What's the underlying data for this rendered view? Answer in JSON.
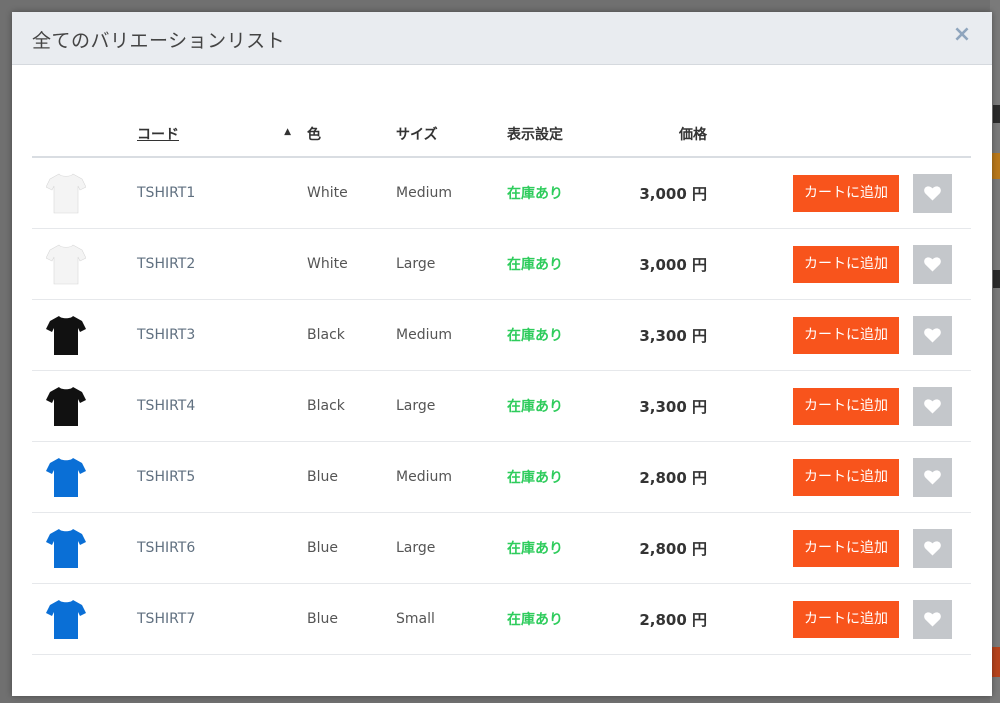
{
  "modal": {
    "title": "全てのバリエーションリスト",
    "close_label": "×"
  },
  "table": {
    "headers": {
      "code": "コード",
      "sort_indicator": "▲",
      "color": "色",
      "size": "サイズ",
      "stock": "表示設定",
      "price": "価格"
    },
    "rows": [
      {
        "shirt_color": "#f4f4f4",
        "code": "TSHIRT1",
        "color": "White",
        "size": "Medium",
        "stock": "在庫あり",
        "price": "3,000 円"
      },
      {
        "shirt_color": "#f4f4f4",
        "code": "TSHIRT2",
        "color": "White",
        "size": "Large",
        "stock": "在庫あり",
        "price": "3,000 円"
      },
      {
        "shirt_color": "#111111",
        "code": "TSHIRT3",
        "color": "Black",
        "size": "Medium",
        "stock": "在庫あり",
        "price": "3,300 円"
      },
      {
        "shirt_color": "#111111",
        "code": "TSHIRT4",
        "color": "Black",
        "size": "Large",
        "stock": "在庫あり",
        "price": "3,300 円"
      },
      {
        "shirt_color": "#0a6fd6",
        "code": "TSHIRT5",
        "color": "Blue",
        "size": "Medium",
        "stock": "在庫あり",
        "price": "2,800 円"
      },
      {
        "shirt_color": "#0a6fd6",
        "code": "TSHIRT6",
        "color": "Blue",
        "size": "Large",
        "stock": "在庫あり",
        "price": "2,800 円"
      },
      {
        "shirt_color": "#0a6fd6",
        "code": "TSHIRT7",
        "color": "Blue",
        "size": "Small",
        "stock": "在庫あり",
        "price": "2,800 円"
      }
    ],
    "add_to_cart_label": "カートに追加",
    "favorite_icon": "heart-icon"
  },
  "colors": {
    "accent": "#f8541c",
    "stock_green": "#2ecc5c",
    "favorite_bg": "#c4c7cb"
  }
}
